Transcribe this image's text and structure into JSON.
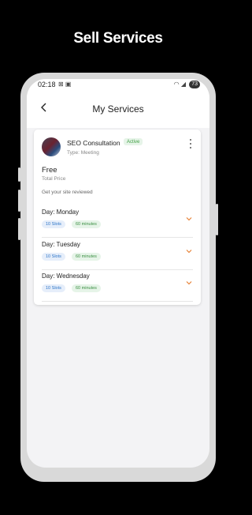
{
  "banner": {
    "title": "Sell Services"
  },
  "status": {
    "time": "02:18",
    "battery": "73"
  },
  "appbar": {
    "title": "My Services"
  },
  "service": {
    "name": "SEO Consultation",
    "status_badge": "Active",
    "type": "Type: Meeting",
    "price": "Free",
    "price_label": "Total Price",
    "description": "Get your site reviewed"
  },
  "days": [
    {
      "label": "Day: Monday",
      "slots": "10 Slots",
      "duration": "60 minutes"
    },
    {
      "label": "Day: Tuesday",
      "slots": "10 Slots",
      "duration": "60 minutes"
    },
    {
      "label": "Day: Wednesday",
      "slots": "10 Slots",
      "duration": "60 minutes"
    }
  ],
  "colors": {
    "active_green": "#43a047",
    "chevron_orange": "#e8833a",
    "chip_blue": "#2e76c8"
  }
}
